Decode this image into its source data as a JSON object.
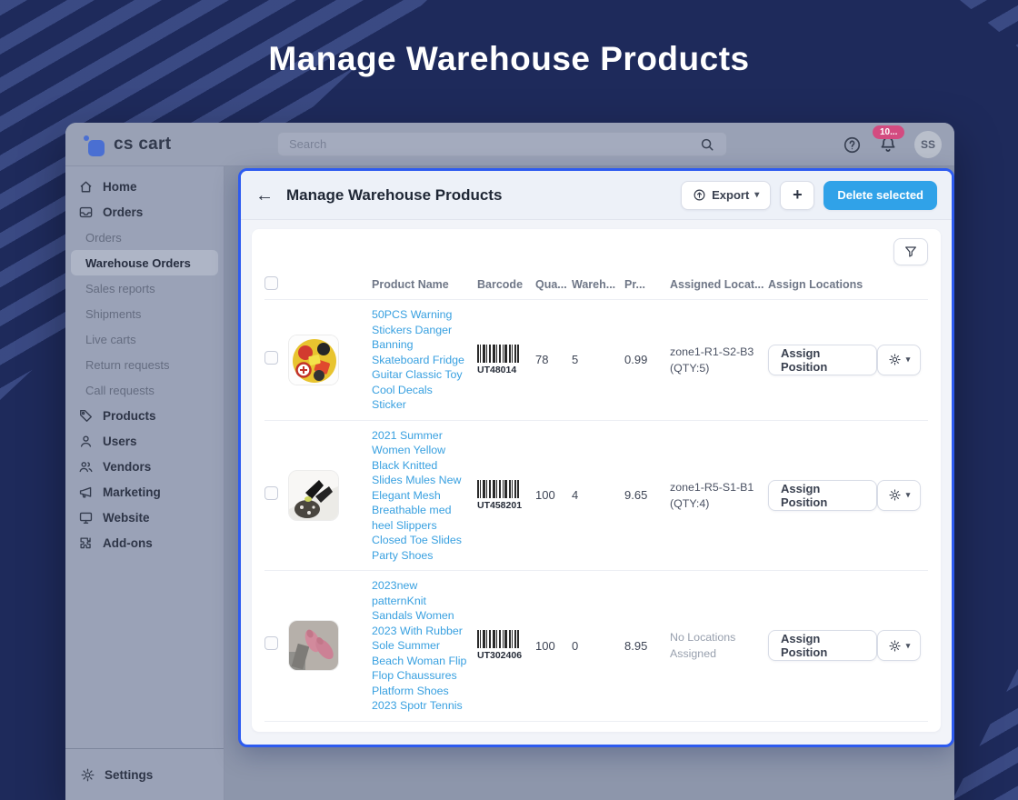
{
  "page_title": "Manage Warehouse Products",
  "colors": {
    "background_navy": "#1e2a5b",
    "panel_border_blue": "#2d5bf0",
    "primary_button_blue": "#30a2e8",
    "link_blue": "#38a0e0",
    "notification_badge_pink": "#d34b80"
  },
  "topbar": {
    "logo_text": "cs cart",
    "search_placeholder": "Search",
    "notification_badge": "10...",
    "avatar_initials": "SS"
  },
  "sidebar": {
    "items": [
      {
        "label": "Home",
        "icon": "home-icon"
      },
      {
        "label": "Orders",
        "icon": "orders-icon"
      },
      {
        "label": "Orders"
      },
      {
        "label": "Warehouse Orders",
        "active": true
      },
      {
        "label": "Sales reports"
      },
      {
        "label": "Shipments"
      },
      {
        "label": "Live carts"
      },
      {
        "label": "Return requests"
      },
      {
        "label": "Call requests"
      },
      {
        "label": "Products",
        "icon": "products-icon"
      },
      {
        "label": "Users",
        "icon": "users-icon"
      },
      {
        "label": "Vendors",
        "icon": "vendors-icon"
      },
      {
        "label": "Marketing",
        "icon": "marketing-icon"
      },
      {
        "label": "Website",
        "icon": "website-icon"
      },
      {
        "label": "Add-ons",
        "icon": "addons-icon"
      }
    ],
    "settings_label": "Settings"
  },
  "panel": {
    "title": "Manage Warehouse Products",
    "back_arrow": "←",
    "export_label": "Export",
    "add_label": "+",
    "delete_label": "Delete selected",
    "caret": "▾"
  },
  "table": {
    "headers": [
      "Product Name",
      "Barcode",
      "Qua...",
      "Wareh...",
      "Pr...",
      "Assigned Locat...",
      "Assign Locations"
    ],
    "rows": [
      {
        "name": "50PCS Warning Stickers Danger Banning Skateboard Fridge Guitar Classic Toy Cool Decals Sticker",
        "barcode": "UT48014",
        "quantity": "78",
        "warehouse": "5",
        "price": "0.99",
        "assigned_location": "zone1-R1-S2-B3 (QTY:5)",
        "assign_label": "Assign Position"
      },
      {
        "name": "2021 Summer Women Yellow Black Knitted Slides Mules New Elegant Mesh Breathable med heel Slippers Closed Toe Slides Party Shoes",
        "barcode": "UT458201",
        "quantity": "100",
        "warehouse": "4",
        "price": "9.65",
        "assigned_location": "zone1-R5-S1-B1 (QTY:4)",
        "assign_label": "Assign Position"
      },
      {
        "name": "2023new patternKnit Sandals Women 2023 With Rubber Sole Summer Beach Woman Flip Flop Chaussures Platform Shoes 2023 Spotr Tennis",
        "barcode": "UT302406",
        "quantity": "100",
        "warehouse": "0",
        "price": "8.95",
        "assigned_location": "No Locations Assigned",
        "assign_label": "Assign Position"
      }
    ]
  }
}
